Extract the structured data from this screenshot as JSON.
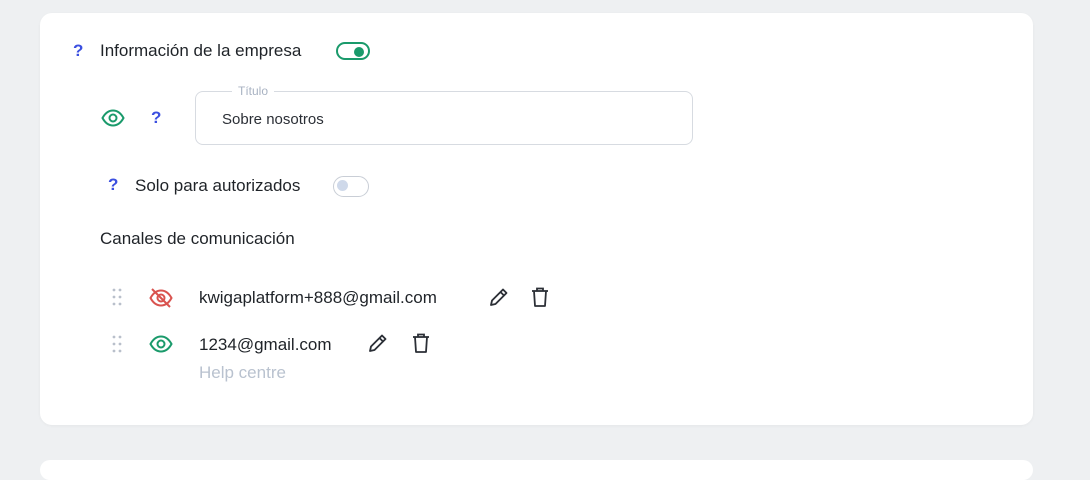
{
  "company_info": {
    "help": "?",
    "title": "Información de la empresa",
    "enabled": true
  },
  "title_field": {
    "help": "?",
    "label": "Título",
    "value": "Sobre nosotros",
    "visible": true
  },
  "authorized": {
    "help": "?",
    "label": "Solo para autorizados",
    "enabled": false
  },
  "channels": {
    "title": "Canales de comunicación",
    "items": [
      {
        "text": "kwigaplatform+888@gmail.com",
        "visible": false
      },
      {
        "text": "1234@gmail.com",
        "visible": true,
        "subtitle": "Help centre"
      }
    ]
  },
  "colors": {
    "accent_green": "#1a9a6b",
    "hidden_red": "#d9534f",
    "help_blue": "#3b4fe0"
  }
}
